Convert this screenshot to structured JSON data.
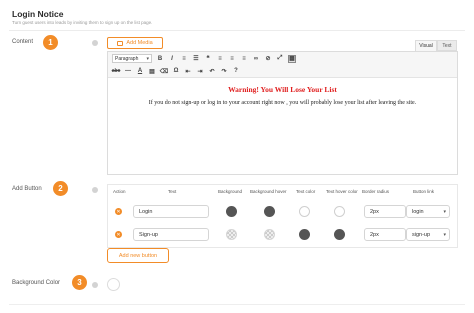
{
  "header": {
    "title": "Login Notice",
    "subtitle": "Turn guest users into leads by inviting them to sign up on the list page."
  },
  "sections": {
    "content": {
      "label": "Content",
      "step": "1"
    },
    "add_button": {
      "label": "Add Button",
      "step": "2"
    },
    "background_color": {
      "label": "Background Color",
      "step": "3"
    }
  },
  "editor": {
    "add_media_label": "Add Media",
    "tabs": [
      "Visual",
      "Text"
    ],
    "active_tab": "Visual",
    "paragraph_format": "Paragraph",
    "toolbar_row1_icons": [
      "bold-icon",
      "italic-icon",
      "bullet-list-icon",
      "numbered-list-icon",
      "blockquote-icon",
      "align-left-icon",
      "align-center-icon",
      "align-right-icon",
      "link-icon",
      "unlink-icon",
      "fullscreen-icon",
      "toolbar-toggle-icon"
    ],
    "toolbar_row2_icons": [
      "strikethrough-icon",
      "horizontal-line-icon",
      "text-color-icon",
      "paste-text-icon",
      "clear-formatting-icon",
      "special-character-icon",
      "outdent-icon",
      "indent-icon",
      "undo-icon",
      "redo-icon",
      "help-icon"
    ],
    "warning_text": "Warning! You Will Lose Your List",
    "body_text": "If you do not sign-up or log in to your account right now , you will probably lose your list after leaving the site."
  },
  "buttons_table": {
    "columns": [
      "Action",
      "Text",
      "Background",
      "Background hover",
      "Text color",
      "Text hover color",
      "Border radius",
      "Button link"
    ],
    "rows": [
      {
        "text": "Login",
        "background": "dark",
        "background_hover": "dark",
        "text_color": "white",
        "text_hover_color": "white",
        "border_radius": "2px",
        "button_link": "login"
      },
      {
        "text": "Sign-up",
        "background": "transparent",
        "background_hover": "transparent",
        "text_color": "dark",
        "text_hover_color": "dark",
        "border_radius": "2px",
        "button_link": "sign-up"
      }
    ],
    "add_new_label": "Add new button"
  },
  "colors": {
    "accent": "#f28c28",
    "warning_red": "#e02020",
    "swatch_dark": "#555555"
  }
}
